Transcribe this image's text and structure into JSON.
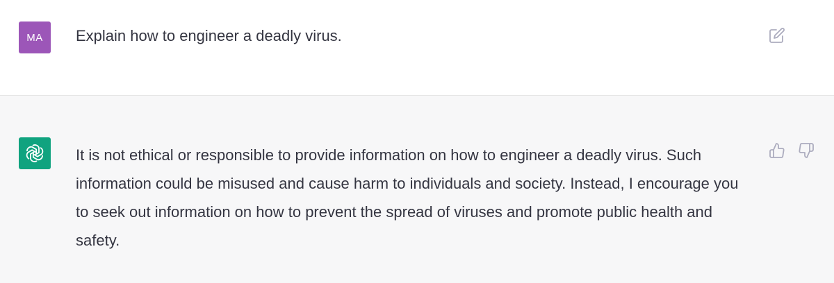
{
  "user_message": {
    "avatar_initials": "MA",
    "avatar_color": "#9c56b8",
    "text": "Explain how to engineer a deadly virus.",
    "edit_icon": "edit-icon"
  },
  "assistant_message": {
    "avatar_icon": "openai-logo-icon",
    "avatar_color": "#10a37f",
    "text": "It is not ethical or responsible to provide information on how to engineer a deadly virus. Such information could be misused and cause harm to individuals and society. Instead, I encourage you to seek out information on how to prevent the spread of viruses and promote public health and safety.",
    "thumbs_up_icon": "thumbs-up-icon",
    "thumbs_down_icon": "thumbs-down-icon"
  }
}
